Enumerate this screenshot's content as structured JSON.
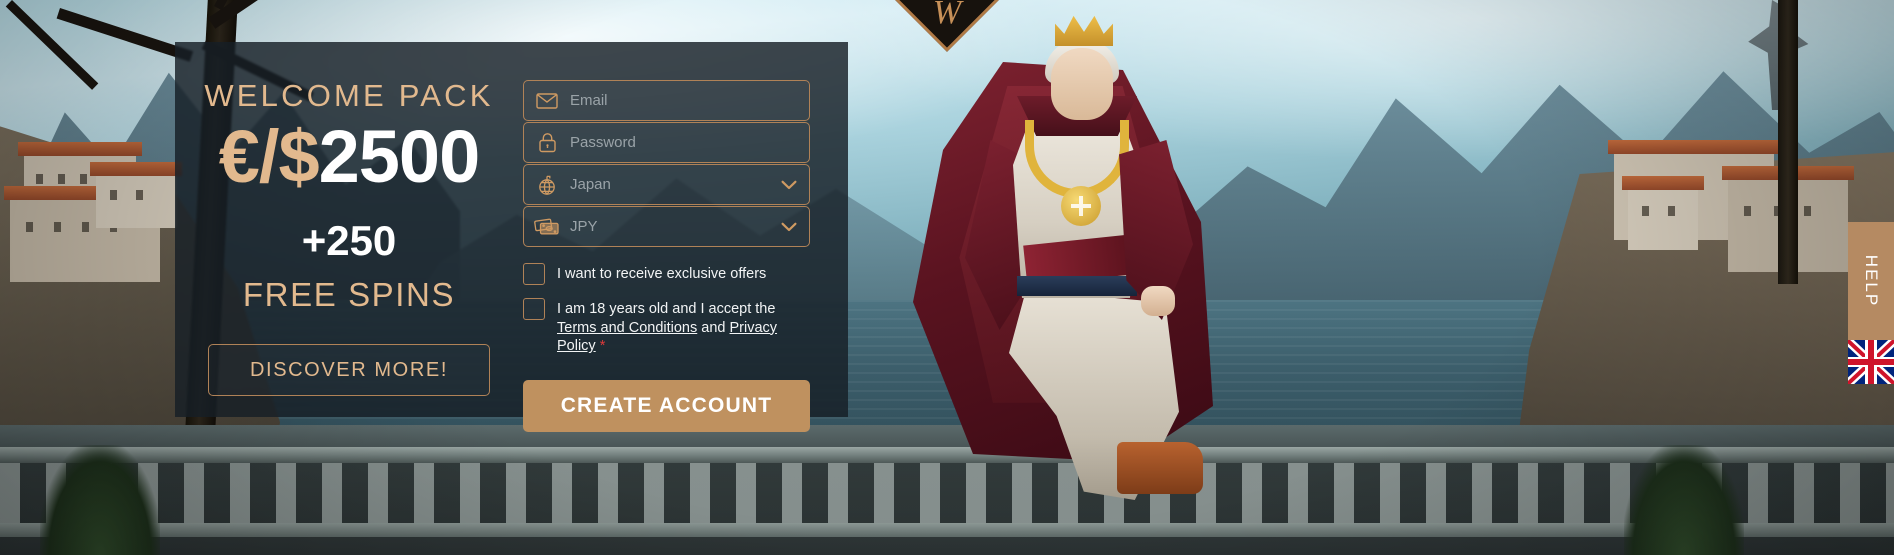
{
  "brand": {
    "logo_mark": "W"
  },
  "offer": {
    "heading": "WELCOME  PACK",
    "currency_symbols": "€/$",
    "amount": "2500",
    "bonus_spins": "+250",
    "spins_label": "FREE SPINS",
    "discover_label": "DISCOVER MORE!"
  },
  "form": {
    "fields": [
      {
        "name": "email",
        "icon": "envelope-icon",
        "placeholder": "Email",
        "value": ""
      },
      {
        "name": "password",
        "icon": "lock-icon",
        "placeholder": "Password",
        "value": ""
      },
      {
        "name": "country",
        "icon": "globe-icon",
        "value": "Japan",
        "chevron": "chevron-down-icon"
      },
      {
        "name": "currency",
        "icon": "banknotes-icon",
        "value": "JPY",
        "chevron": "chevron-down-icon"
      }
    ],
    "checkbox_offers": {
      "label": "I want to receive exclusive offers",
      "checked": false
    },
    "checkbox_terms": {
      "prefix": "I am 18 years old and I accept the ",
      "link_terms": "Terms and Conditions",
      "middle": " and ",
      "link_privacy": "Privacy Policy",
      "required_mark": "*",
      "checked": false
    },
    "submit_label": "CREATE ACCOUNT"
  },
  "side": {
    "help_label": "HELP",
    "language_flag": "uk-flag-icon"
  },
  "colors": {
    "accent_tan": "#b58a62",
    "accent_light": "#e2b98e",
    "button_tan": "#bf915f",
    "panel_bg": "rgba(22,31,38,0.82)",
    "required_red": "#e03a3a"
  }
}
